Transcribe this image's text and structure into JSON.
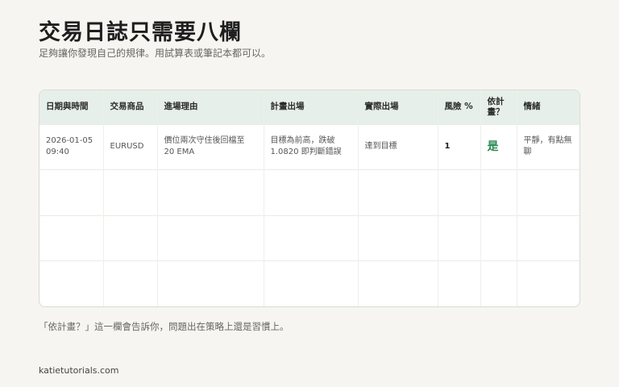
{
  "header": {
    "title": "交易日誌只需要八欄",
    "subtitle": "足夠讓你發現自己的規律。用試算表或筆記本都可以。"
  },
  "table": {
    "columns": [
      "日期與時間",
      "交易商品",
      "進場理由",
      "計畫出場",
      "實際出場",
      "風險 %",
      "依計畫？",
      "情緒"
    ],
    "rows": [
      {
        "date": "2026-01-05 09:40",
        "symbol": "EURUSD",
        "entry_reason": "價位兩次守住後回檔至 20 EMA",
        "planned_exit": "目標為前高，跌破 1.0820 即判斷錯誤",
        "actual_exit": "達到目標",
        "risk_pct": "1",
        "followed_plan": "是",
        "emotion": "平靜，有點無聊"
      }
    ]
  },
  "note": "「依計畫？」這一欄會告訴你，問題出在策略上還是習慣上。",
  "footer": "katietutorials.com",
  "colors": {
    "background": "#f6f5f1",
    "header_row": "#e6efe9",
    "yes_green": "#2f8a57"
  }
}
